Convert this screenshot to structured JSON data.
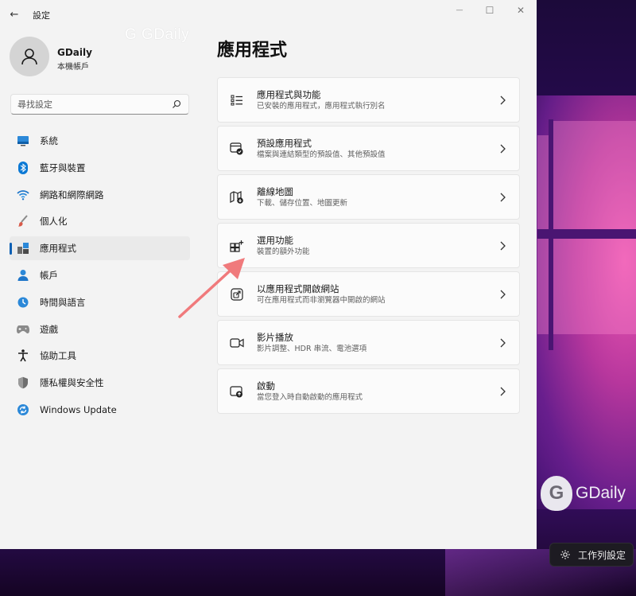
{
  "window": {
    "app_title": "設定",
    "back_glyph": "←",
    "controls": {
      "minimize": "—",
      "maximize": "☐",
      "close": "✕"
    }
  },
  "watermark": {
    "window_text": "G GDaily",
    "logo_letter": "G",
    "desktop_text": "GDaily"
  },
  "profile": {
    "name": "GDaily",
    "subtitle": "本機帳戶"
  },
  "search": {
    "placeholder": "尋找設定",
    "icon": "search-icon"
  },
  "nav": {
    "items": [
      {
        "label": "系統",
        "icon": "system-icon"
      },
      {
        "label": "藍牙與裝置",
        "icon": "bluetooth-icon"
      },
      {
        "label": "網路和網際網路",
        "icon": "wifi-icon"
      },
      {
        "label": "個人化",
        "icon": "brush-icon"
      },
      {
        "label": "應用程式",
        "icon": "apps-icon",
        "active": true
      },
      {
        "label": "帳戶",
        "icon": "person-icon"
      },
      {
        "label": "時間與語言",
        "icon": "globe-clock-icon"
      },
      {
        "label": "遊戲",
        "icon": "gamepad-icon"
      },
      {
        "label": "協助工具",
        "icon": "accessibility-icon"
      },
      {
        "label": "隱私權與安全性",
        "icon": "shield-icon"
      },
      {
        "label": "Windows Update",
        "icon": "update-icon"
      }
    ]
  },
  "main": {
    "title": "應用程式",
    "cards": [
      {
        "title": "應用程式與功能",
        "subtitle": "已安裝的應用程式，應用程式執行別名",
        "icon": "list-icon"
      },
      {
        "title": "預設應用程式",
        "subtitle": "檔案與連結類型的預設值、其他預設值",
        "icon": "default-apps-icon"
      },
      {
        "title": "離線地圖",
        "subtitle": "下載、儲存位置、地圖更新",
        "icon": "map-download-icon"
      },
      {
        "title": "選用功能",
        "subtitle": "裝置的額外功能",
        "icon": "optional-features-icon"
      },
      {
        "title": "以應用程式開啟網站",
        "subtitle": "可在應用程式而非瀏覽器中開啟的網站",
        "icon": "open-external-icon"
      },
      {
        "title": "影片播放",
        "subtitle": "影片調整、HDR 串流、電池選項",
        "icon": "video-icon"
      },
      {
        "title": "啟動",
        "subtitle": "當您登入時自動啟動的應用程式",
        "icon": "startup-icon"
      }
    ]
  },
  "taskbar_chip": {
    "label": "工作列設定",
    "icon": "gear-icon"
  },
  "colors": {
    "accent": "#0a5fb4",
    "annotation_arrow": "#f07a7c",
    "window_bg": "#f3f3f3"
  }
}
